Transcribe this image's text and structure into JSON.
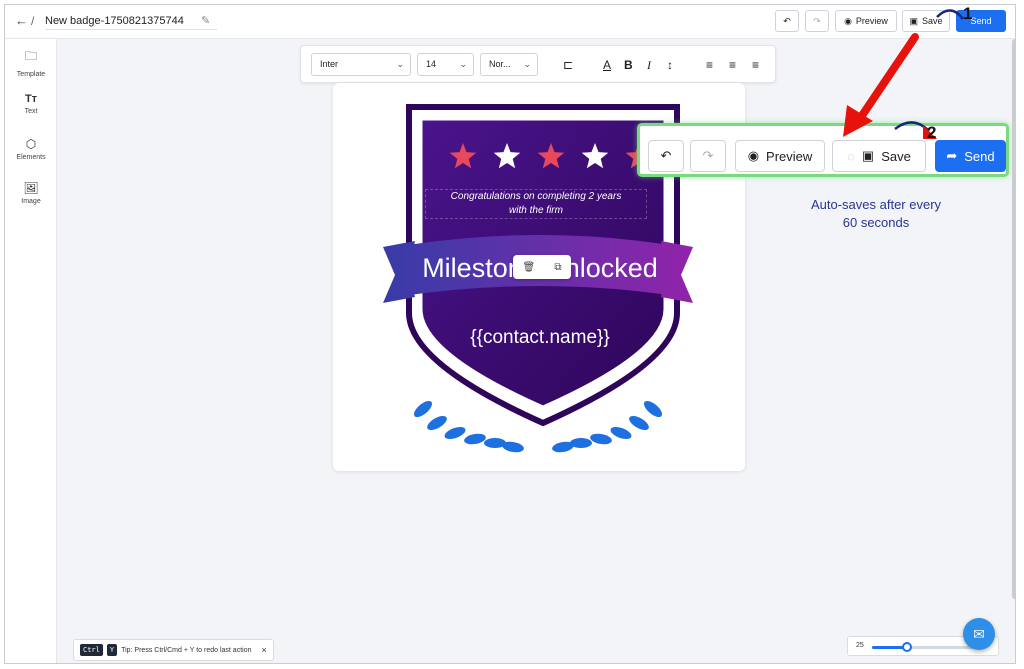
{
  "header": {
    "back": "←",
    "separator": "/",
    "title": "New badge-1750821375744",
    "undo": "↶",
    "redo": "↷",
    "preview_label": "Preview",
    "save_label": "Save",
    "send_label": "Send"
  },
  "sidebar": {
    "items": [
      {
        "icon": "🗀",
        "label": "Template"
      },
      {
        "icon": "Tт",
        "label": "Text"
      },
      {
        "icon": "⬡",
        "label": "Elements"
      },
      {
        "icon": "🖼",
        "label": "Image"
      }
    ]
  },
  "format_toolbar": {
    "font": "Inter",
    "size": "14",
    "weight": "Nor...",
    "chevron": "⌄"
  },
  "badge": {
    "congrats_line1": "Congratulations on completing 2 years",
    "congrats_line2": "with the firm",
    "headline": "Milestone Unlocked",
    "contact": "{{contact.name}}",
    "stars": [
      {
        "color": "#e8485b"
      },
      {
        "color": "#ffffff"
      },
      {
        "color": "#e8485b"
      },
      {
        "color": "#ffffff"
      },
      {
        "color": "#e8485b"
      }
    ],
    "colors": {
      "shield_dark": "#2e0559",
      "shield_light": "#4a148c",
      "ribbon_left": "#3b3ba8",
      "ribbon_right": "#8e24aa",
      "laurel": "#1e6fe0"
    }
  },
  "callout": {
    "preview_label": "Preview",
    "save_label": "Save",
    "send_label": "Send",
    "autosave_line1": "Auto-saves after every",
    "autosave_line2": "60 seconds",
    "step1": "1",
    "step2": "2"
  },
  "tip": {
    "key1": "Ctrl",
    "key2": "Y",
    "text": "Tip: Press Ctrl/Cmd + Y to redo last action",
    "close": "×"
  },
  "zoom": {
    "value": "25",
    "fraction": 0.32
  },
  "colors": {
    "accent": "#1d6ff2",
    "arrow": "#e8120c",
    "callout_border": "#7bd982"
  }
}
